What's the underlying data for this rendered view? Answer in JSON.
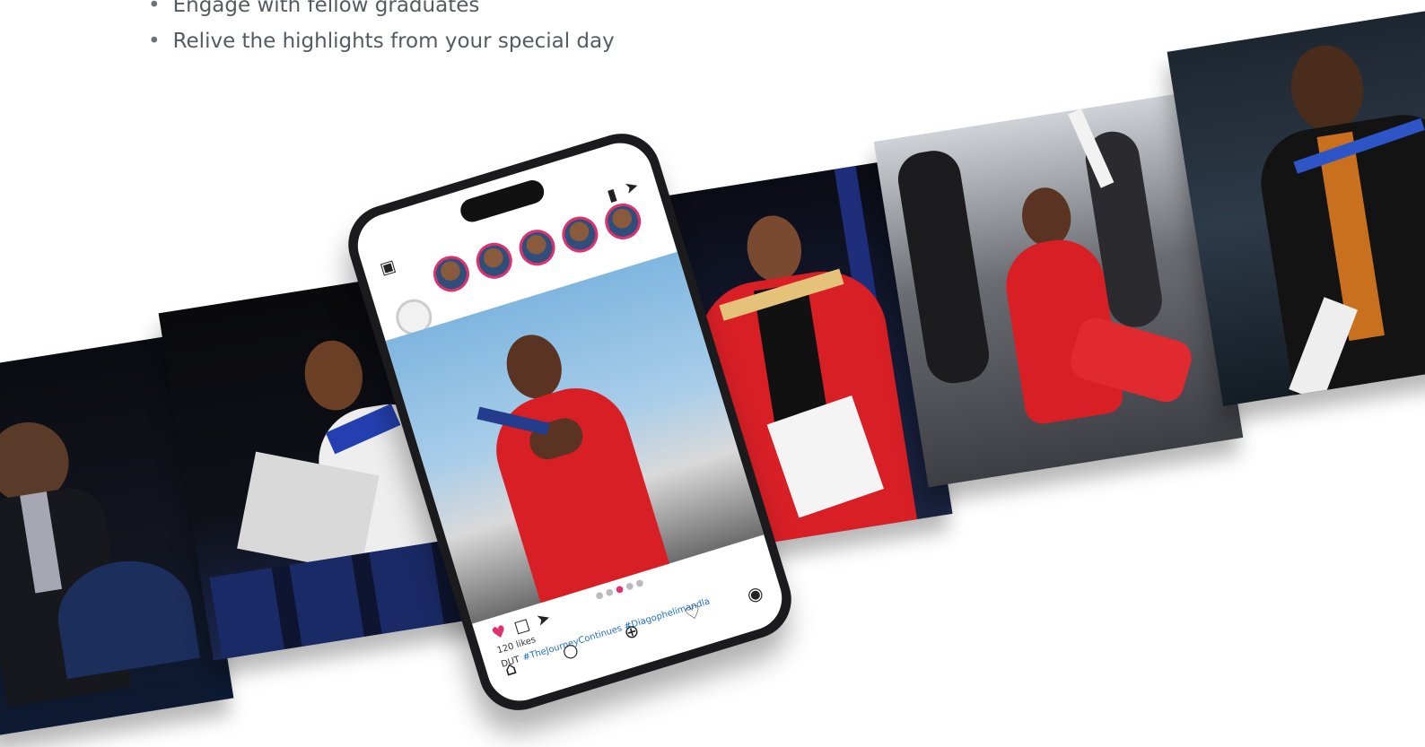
{
  "bullets": [
    "Engage with fellow graduates",
    "Relive the highlights from your special day"
  ],
  "phone": {
    "likes": "120 likes",
    "account": "DUT",
    "caption": "#TheJourneyContinues #Diagophelimandla"
  },
  "colors": {
    "text_gray": "#555b61",
    "gown_red": "#d81f26",
    "story_ring": "#e1306c",
    "hashtag_blue": "#1e6fd6"
  }
}
